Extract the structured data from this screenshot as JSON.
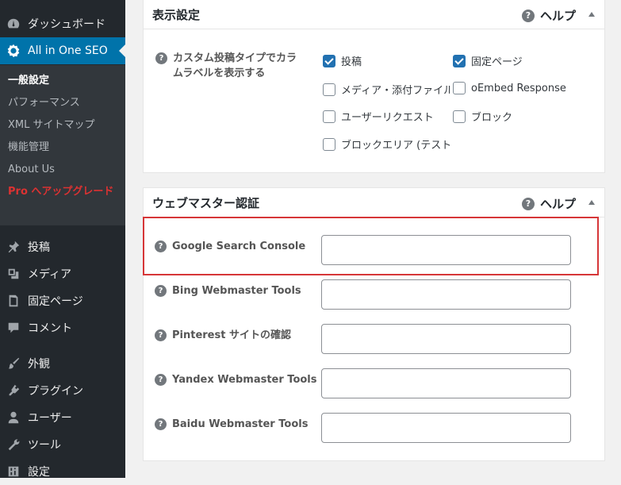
{
  "sidebar": {
    "dashboard": "ダッシュボード",
    "aioseo": "All in One SEO",
    "submenu": [
      "一般設定",
      "パフォーマンス",
      "XML サイトマップ",
      "機能管理",
      "About Us"
    ],
    "pro_prefix": "Pro",
    "pro_rest": " へアップグレード",
    "items": [
      {
        "label": "投稿",
        "icon": "pin-icon"
      },
      {
        "label": "メディア",
        "icon": "media-icon"
      },
      {
        "label": "固定ページ",
        "icon": "page-icon"
      },
      {
        "label": "コメント",
        "icon": "comment-icon"
      },
      {
        "label": "外観",
        "icon": "brush-icon"
      },
      {
        "label": "プラグイン",
        "icon": "plugin-icon"
      },
      {
        "label": "ユーザー",
        "icon": "user-icon"
      },
      {
        "label": "ツール",
        "icon": "wrench-icon"
      },
      {
        "label": "設定",
        "icon": "settings-icon"
      }
    ]
  },
  "display_panel": {
    "title": "表示設定",
    "help": "ヘルプ",
    "row_label": "カスタム投稿タイプでカラムラベルを表示する",
    "checkboxes": [
      {
        "label": "投稿",
        "checked": true
      },
      {
        "label": "固定ページ",
        "checked": true
      },
      {
        "label": "メディア・添付ファイル",
        "checked": false
      },
      {
        "label": "oEmbed Response",
        "checked": false
      },
      {
        "label": "ユーザーリクエスト",
        "checked": false
      },
      {
        "label": "ブロック",
        "checked": false
      },
      {
        "label": "ブロックエリア (テスト",
        "checked": false
      }
    ]
  },
  "webmaster_panel": {
    "title": "ウェブマスター認証",
    "help": "ヘルプ",
    "fields": [
      {
        "label": "Google Search Console",
        "value": ""
      },
      {
        "label": "Bing Webmaster Tools",
        "value": ""
      },
      {
        "label": "Pinterest サイトの確認",
        "value": ""
      },
      {
        "label": "Yandex Webmaster Tools",
        "value": ""
      },
      {
        "label": "Baidu Webmaster Tools",
        "value": ""
      }
    ]
  },
  "colors": {
    "accent": "#0073aa",
    "highlight": "#d63638",
    "sidebar": "#23282d",
    "pro": "#dc3232"
  }
}
